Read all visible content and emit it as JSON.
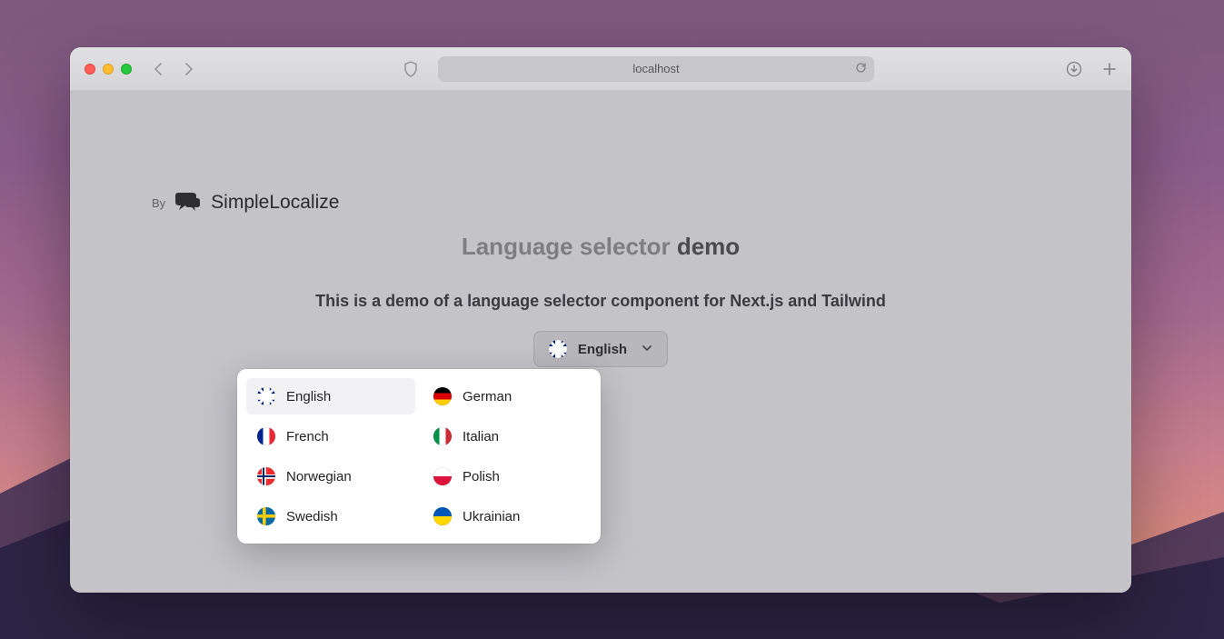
{
  "browser": {
    "url_display": "localhost"
  },
  "byline": {
    "prefix": "By",
    "brand": "SimpleLocalize"
  },
  "hero": {
    "title_light": "Language selector ",
    "title_bold": "demo",
    "subtitle": "This is a demo of a language selector component for Next.js and Tailwind"
  },
  "selector": {
    "current_label": "English",
    "current_flag": "gb",
    "options": [
      {
        "label": "English",
        "flag": "gb",
        "selected": true
      },
      {
        "label": "German",
        "flag": "de",
        "selected": false
      },
      {
        "label": "French",
        "flag": "fr",
        "selected": false
      },
      {
        "label": "Italian",
        "flag": "it",
        "selected": false
      },
      {
        "label": "Norwegian",
        "flag": "no",
        "selected": false
      },
      {
        "label": "Polish",
        "flag": "pl",
        "selected": false
      },
      {
        "label": "Swedish",
        "flag": "se",
        "selected": false
      },
      {
        "label": "Ukrainian",
        "flag": "ua",
        "selected": false
      }
    ]
  }
}
